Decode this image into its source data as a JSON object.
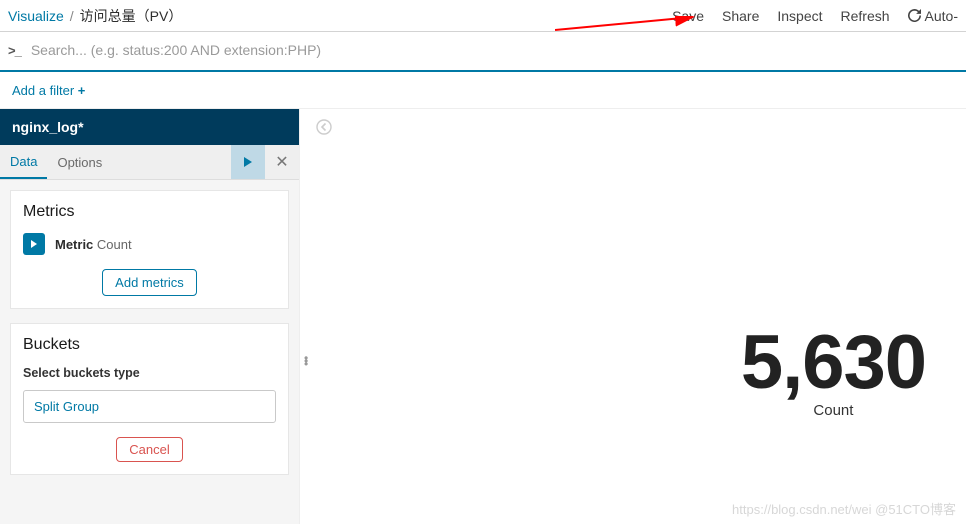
{
  "breadcrumb": {
    "root": "Visualize",
    "sep": "/",
    "current": "访问总量（PV）"
  },
  "actions": {
    "save": "Save",
    "share": "Share",
    "inspect": "Inspect",
    "refresh": "Refresh",
    "auto": "Auto-"
  },
  "search": {
    "placeholder": "Search... (e.g. status:200 AND extension:PHP)"
  },
  "filterbar": {
    "add": "Add a filter",
    "plus": "+"
  },
  "sidebar": {
    "index_pattern": "nginx_log*",
    "tabs": {
      "data": "Data",
      "options": "Options"
    },
    "metrics": {
      "heading": "Metrics",
      "row_label": "Metric",
      "row_value": "Count",
      "add_btn": "Add metrics"
    },
    "buckets": {
      "heading": "Buckets",
      "select_label": "Select buckets type",
      "option": "Split Group",
      "cancel": "Cancel"
    }
  },
  "chart_data": {
    "type": "metric",
    "value": "5,630",
    "label": "Count"
  },
  "watermark": "https://blog.csdn.net/wei  @51CTO博客"
}
